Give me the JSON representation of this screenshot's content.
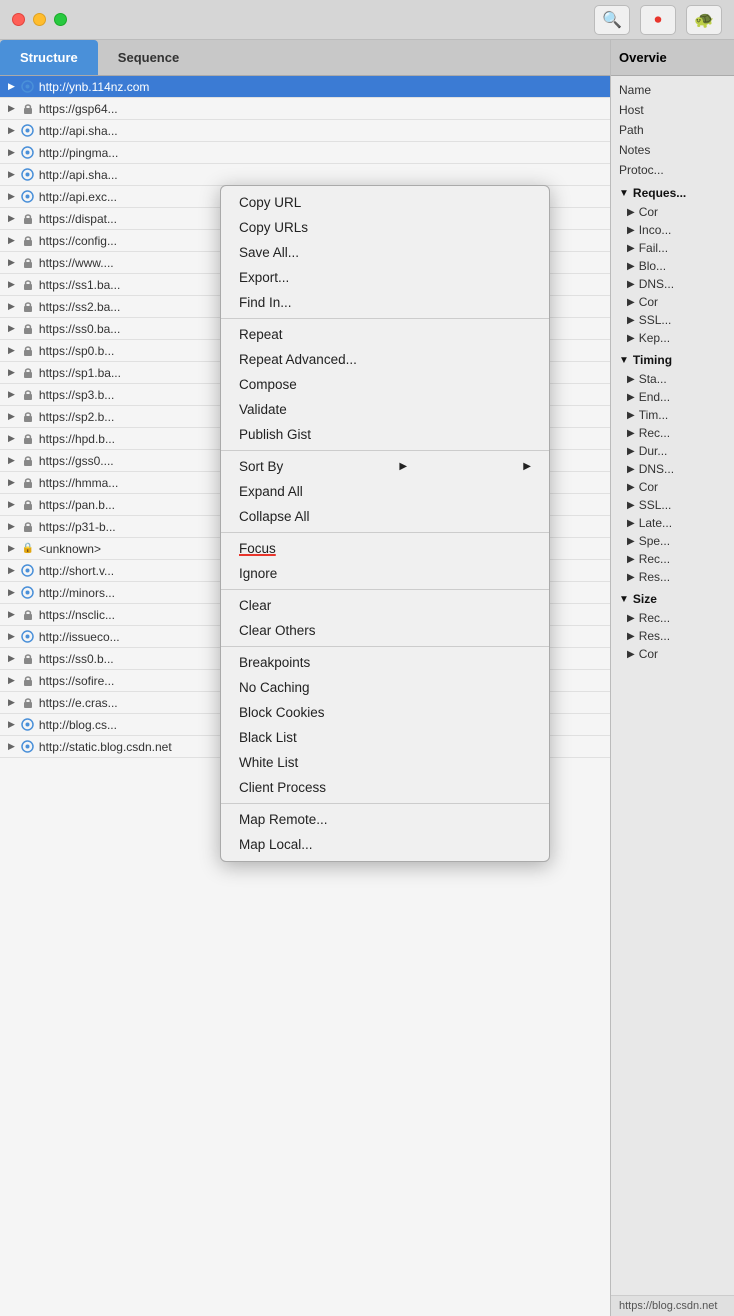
{
  "titleBar": {
    "trafficLights": [
      "red",
      "yellow",
      "green"
    ],
    "toolbarBtns": [
      {
        "name": "pointer-tool",
        "icon": "🔍"
      },
      {
        "name": "record-btn",
        "icon": "⏺"
      },
      {
        "name": "turtle-btn",
        "icon": "🐢"
      }
    ]
  },
  "tabs": [
    {
      "label": "Structure",
      "active": true
    },
    {
      "label": "Sequence",
      "active": false
    }
  ],
  "rightHeader": "Overvie",
  "urlList": [
    {
      "url": "http://ynb.114nz.com",
      "selected": true,
      "secure": false,
      "type": "http"
    },
    {
      "url": "https://gsp64...",
      "selected": false,
      "secure": true,
      "type": "https"
    },
    {
      "url": "http://api.sha...",
      "selected": false,
      "secure": false,
      "type": "http"
    },
    {
      "url": "http://pingma...",
      "selected": false,
      "secure": false,
      "type": "http"
    },
    {
      "url": "http://api.sha...",
      "selected": false,
      "secure": false,
      "type": "http"
    },
    {
      "url": "http://api.exc...",
      "selected": false,
      "secure": false,
      "type": "http"
    },
    {
      "url": "https://dispat...",
      "selected": false,
      "secure": true,
      "type": "https"
    },
    {
      "url": "https://config...",
      "selected": false,
      "secure": true,
      "type": "https"
    },
    {
      "url": "https://www....",
      "selected": false,
      "secure": true,
      "type": "https"
    },
    {
      "url": "https://ss1.ba...",
      "selected": false,
      "secure": true,
      "type": "https"
    },
    {
      "url": "https://ss2.ba...",
      "selected": false,
      "secure": true,
      "type": "https"
    },
    {
      "url": "https://ss0.ba...",
      "selected": false,
      "secure": true,
      "type": "https"
    },
    {
      "url": "https://sp0.b...",
      "selected": false,
      "secure": true,
      "type": "https"
    },
    {
      "url": "https://sp1.ba...",
      "selected": false,
      "secure": true,
      "type": "https"
    },
    {
      "url": "https://sp3.b...",
      "selected": false,
      "secure": true,
      "type": "https"
    },
    {
      "url": "https://sp2.b...",
      "selected": false,
      "secure": true,
      "type": "https"
    },
    {
      "url": "https://hpd.b...",
      "selected": false,
      "secure": true,
      "type": "https"
    },
    {
      "url": "https://gss0....",
      "selected": false,
      "secure": true,
      "type": "https"
    },
    {
      "url": "https://hmma...",
      "selected": false,
      "secure": true,
      "type": "https"
    },
    {
      "url": "https://pan.b...",
      "selected": false,
      "secure": true,
      "type": "https"
    },
    {
      "url": "https://p31-b...",
      "selected": false,
      "secure": true,
      "type": "https"
    },
    {
      "url": "<unknown>",
      "selected": false,
      "secure": true,
      "type": "unknown"
    },
    {
      "url": "http://short.v...",
      "selected": false,
      "secure": false,
      "type": "http"
    },
    {
      "url": "http://minors...",
      "selected": false,
      "secure": false,
      "type": "http"
    },
    {
      "url": "https://nsclic...",
      "selected": false,
      "secure": true,
      "type": "https"
    },
    {
      "url": "http://issueco...",
      "selected": false,
      "secure": false,
      "type": "http"
    },
    {
      "url": "https://ss0.b...",
      "selected": false,
      "secure": true,
      "type": "https"
    },
    {
      "url": "https://sofire...",
      "selected": false,
      "secure": true,
      "type": "https"
    },
    {
      "url": "https://e.cras...",
      "selected": false,
      "secure": true,
      "type": "https"
    },
    {
      "url": "http://blog.cs...",
      "selected": false,
      "secure": false,
      "type": "http"
    },
    {
      "url": "http://static.blog.csdn.net",
      "selected": false,
      "secure": false,
      "type": "http"
    }
  ],
  "contextMenu": {
    "items": [
      {
        "label": "Copy URL",
        "type": "item",
        "hasArrow": false
      },
      {
        "label": "Copy URLs",
        "type": "item",
        "hasArrow": false
      },
      {
        "label": "Save All...",
        "type": "item",
        "hasArrow": false
      },
      {
        "label": "Export...",
        "type": "item",
        "hasArrow": false
      },
      {
        "label": "Find In...",
        "type": "item",
        "hasArrow": false
      },
      {
        "type": "separator"
      },
      {
        "label": "Repeat",
        "type": "item",
        "hasArrow": false
      },
      {
        "label": "Repeat Advanced...",
        "type": "item",
        "hasArrow": false
      },
      {
        "label": "Compose",
        "type": "item",
        "hasArrow": false
      },
      {
        "label": "Validate",
        "type": "item",
        "hasArrow": false
      },
      {
        "label": "Publish Gist",
        "type": "item",
        "hasArrow": false
      },
      {
        "type": "separator"
      },
      {
        "label": "Sort By",
        "type": "item",
        "hasArrow": true
      },
      {
        "label": "Expand All",
        "type": "item",
        "hasArrow": false
      },
      {
        "label": "Collapse All",
        "type": "item",
        "hasArrow": false
      },
      {
        "type": "separator"
      },
      {
        "label": "Focus",
        "type": "item",
        "hasArrow": false,
        "underline": true
      },
      {
        "label": "Ignore",
        "type": "item",
        "hasArrow": false
      },
      {
        "type": "separator"
      },
      {
        "label": "Clear",
        "type": "item",
        "hasArrow": false
      },
      {
        "label": "Clear Others",
        "type": "item",
        "hasArrow": false
      },
      {
        "type": "separator"
      },
      {
        "label": "Breakpoints",
        "type": "item",
        "hasArrow": false
      },
      {
        "label": "No Caching",
        "type": "item",
        "hasArrow": false
      },
      {
        "label": "Block Cookies",
        "type": "item",
        "hasArrow": false
      },
      {
        "label": "Black List",
        "type": "item",
        "hasArrow": false
      },
      {
        "label": "White List",
        "type": "item",
        "hasArrow": false
      },
      {
        "label": "Client Process",
        "type": "item",
        "hasArrow": false
      },
      {
        "type": "separator"
      },
      {
        "label": "Map Remote...",
        "type": "item",
        "hasArrow": false
      },
      {
        "label": "Map Local...",
        "type": "item",
        "hasArrow": false
      }
    ]
  },
  "overviewPanel": {
    "title": "Overvie",
    "items": [
      {
        "label": "Name",
        "type": "plain"
      },
      {
        "label": "Host",
        "type": "plain"
      },
      {
        "label": "Path",
        "type": "plain"
      },
      {
        "label": "Notes",
        "type": "plain"
      },
      {
        "label": "Protoc...",
        "type": "plain"
      },
      {
        "label": "Reques...",
        "type": "section"
      },
      {
        "label": "Cor",
        "type": "sub"
      },
      {
        "label": "Inco...",
        "type": "sub"
      },
      {
        "label": "Fail...",
        "type": "sub"
      },
      {
        "label": "Blo...",
        "type": "sub"
      },
      {
        "label": "DNS...",
        "type": "sub"
      },
      {
        "label": "Cor",
        "type": "sub"
      },
      {
        "label": "SSL...",
        "type": "sub"
      },
      {
        "label": "Kep...",
        "type": "sub"
      },
      {
        "label": "Timing",
        "type": "section"
      },
      {
        "label": "Sta...",
        "type": "sub"
      },
      {
        "label": "End...",
        "type": "sub"
      },
      {
        "label": "Tim...",
        "type": "sub"
      },
      {
        "label": "Rec...",
        "type": "sub"
      },
      {
        "label": "Dur...",
        "type": "sub"
      },
      {
        "label": "DNS...",
        "type": "sub"
      },
      {
        "label": "Cor",
        "type": "sub"
      },
      {
        "label": "SSL...",
        "type": "sub"
      },
      {
        "label": "Late...",
        "type": "sub"
      },
      {
        "label": "Spe...",
        "type": "sub"
      },
      {
        "label": "Rec...",
        "type": "sub"
      },
      {
        "label": "Res...",
        "type": "sub"
      },
      {
        "label": "Size",
        "type": "section"
      },
      {
        "label": "Rec...",
        "type": "sub"
      },
      {
        "label": "Res...",
        "type": "sub"
      },
      {
        "label": "Cor",
        "type": "sub"
      }
    ]
  },
  "statusBar": {
    "text": "https://blog.csdn.net"
  }
}
